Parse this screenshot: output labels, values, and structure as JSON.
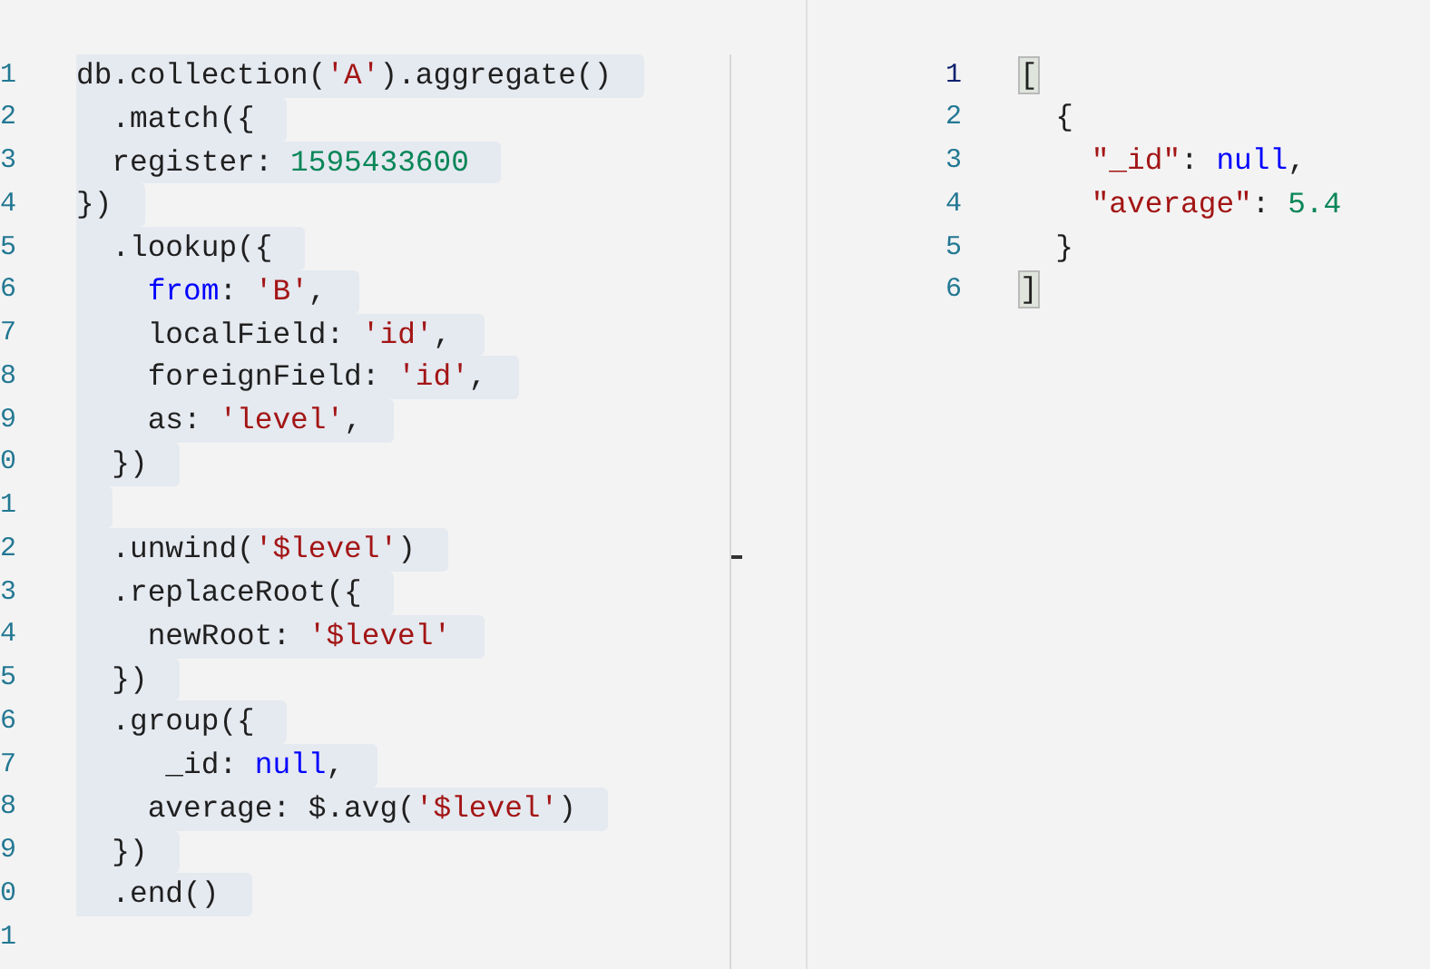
{
  "editor": {
    "lines": [
      {
        "number": "1",
        "highlighted": true,
        "tokens": [
          {
            "kind": "plain",
            "text": "db.collection("
          },
          {
            "kind": "string",
            "text": "'A'"
          },
          {
            "kind": "plain",
            "text": ").aggregate()"
          }
        ]
      },
      {
        "number": "2",
        "highlighted": true,
        "tokens": [
          {
            "kind": "plain",
            "text": "  .match({"
          }
        ]
      },
      {
        "number": "3",
        "highlighted": true,
        "tokens": [
          {
            "kind": "plain",
            "text": "  register: "
          },
          {
            "kind": "number",
            "text": "1595433600"
          }
        ]
      },
      {
        "number": "4",
        "highlighted": true,
        "tokens": [
          {
            "kind": "plain",
            "text": "})"
          }
        ]
      },
      {
        "number": "5",
        "highlighted": true,
        "tokens": [
          {
            "kind": "plain",
            "text": "  .lookup({"
          }
        ]
      },
      {
        "number": "6",
        "highlighted": true,
        "tokens": [
          {
            "kind": "keyword",
            "text": "    from"
          },
          {
            "kind": "plain",
            "text": ": "
          },
          {
            "kind": "string",
            "text": "'B'"
          },
          {
            "kind": "plain",
            "text": ","
          }
        ]
      },
      {
        "number": "7",
        "highlighted": true,
        "tokens": [
          {
            "kind": "plain",
            "text": "    localField: "
          },
          {
            "kind": "string",
            "text": "'id'"
          },
          {
            "kind": "plain",
            "text": ","
          }
        ]
      },
      {
        "number": "8",
        "highlighted": true,
        "tokens": [
          {
            "kind": "plain",
            "text": "    foreignField: "
          },
          {
            "kind": "string",
            "text": "'id'"
          },
          {
            "kind": "plain",
            "text": ","
          }
        ]
      },
      {
        "number": "9",
        "highlighted": true,
        "tokens": [
          {
            "kind": "plain",
            "text": "    as: "
          },
          {
            "kind": "string",
            "text": "'level'"
          },
          {
            "kind": "plain",
            "text": ","
          }
        ]
      },
      {
        "number": "0",
        "highlighted": true,
        "tokens": [
          {
            "kind": "plain",
            "text": "  })"
          }
        ]
      },
      {
        "number": "1",
        "highlighted": true
      },
      {
        "number": "2",
        "highlighted": true,
        "tokens": [
          {
            "kind": "plain",
            "text": "  .unwind("
          },
          {
            "kind": "string",
            "text": "'$level'"
          },
          {
            "kind": "plain",
            "text": ")"
          }
        ]
      },
      {
        "number": "3",
        "highlighted": true,
        "tokens": [
          {
            "kind": "plain",
            "text": "  .replaceRoot({"
          }
        ]
      },
      {
        "number": "4",
        "highlighted": true,
        "tokens": [
          {
            "kind": "plain",
            "text": "    newRoot: "
          },
          {
            "kind": "string",
            "text": "'$level'"
          }
        ]
      },
      {
        "number": "5",
        "highlighted": true,
        "tokens": [
          {
            "kind": "plain",
            "text": "  })"
          }
        ]
      },
      {
        "number": "6",
        "highlighted": true,
        "tokens": [
          {
            "kind": "plain",
            "text": "  .group({"
          }
        ]
      },
      {
        "number": "7",
        "highlighted": true,
        "tokens": [
          {
            "kind": "plain",
            "text": "     _id: "
          },
          {
            "kind": "keyword",
            "text": "null"
          },
          {
            "kind": "plain",
            "text": ","
          }
        ]
      },
      {
        "number": "8",
        "highlighted": true,
        "tokens": [
          {
            "kind": "plain",
            "text": "    average: $.avg("
          },
          {
            "kind": "string",
            "text": "'$level'"
          },
          {
            "kind": "plain",
            "text": ")"
          }
        ]
      },
      {
        "number": "9",
        "highlighted": true,
        "tokens": [
          {
            "kind": "plain",
            "text": "  })"
          }
        ]
      },
      {
        "number": "0",
        "highlighted": true,
        "tokens": [
          {
            "kind": "plain",
            "text": "  .end()"
          }
        ]
      },
      {
        "number": "1",
        "highlighted": false
      }
    ]
  },
  "output": {
    "lines": [
      {
        "number": "1",
        "active": true,
        "tokens": [
          {
            "kind": "bracket",
            "text": "["
          }
        ]
      },
      {
        "number": "2",
        "active": false,
        "tokens": [
          {
            "kind": "plain",
            "text": "  {"
          }
        ]
      },
      {
        "number": "3",
        "active": false,
        "tokens": [
          {
            "kind": "string",
            "text": "    \"_id\""
          },
          {
            "kind": "plain",
            "text": ": "
          },
          {
            "kind": "keyword",
            "text": "null"
          },
          {
            "kind": "plain",
            "text": ","
          }
        ]
      },
      {
        "number": "4",
        "active": false,
        "tokens": [
          {
            "kind": "string",
            "text": "    \"average\""
          },
          {
            "kind": "plain",
            "text": ": "
          },
          {
            "kind": "number",
            "text": "5.4"
          }
        ]
      },
      {
        "number": "5",
        "active": false,
        "tokens": [
          {
            "kind": "plain",
            "text": "  }"
          }
        ]
      },
      {
        "number": "6",
        "active": false,
        "tokens": [
          {
            "kind": "bracket",
            "text": "]"
          }
        ]
      }
    ]
  }
}
